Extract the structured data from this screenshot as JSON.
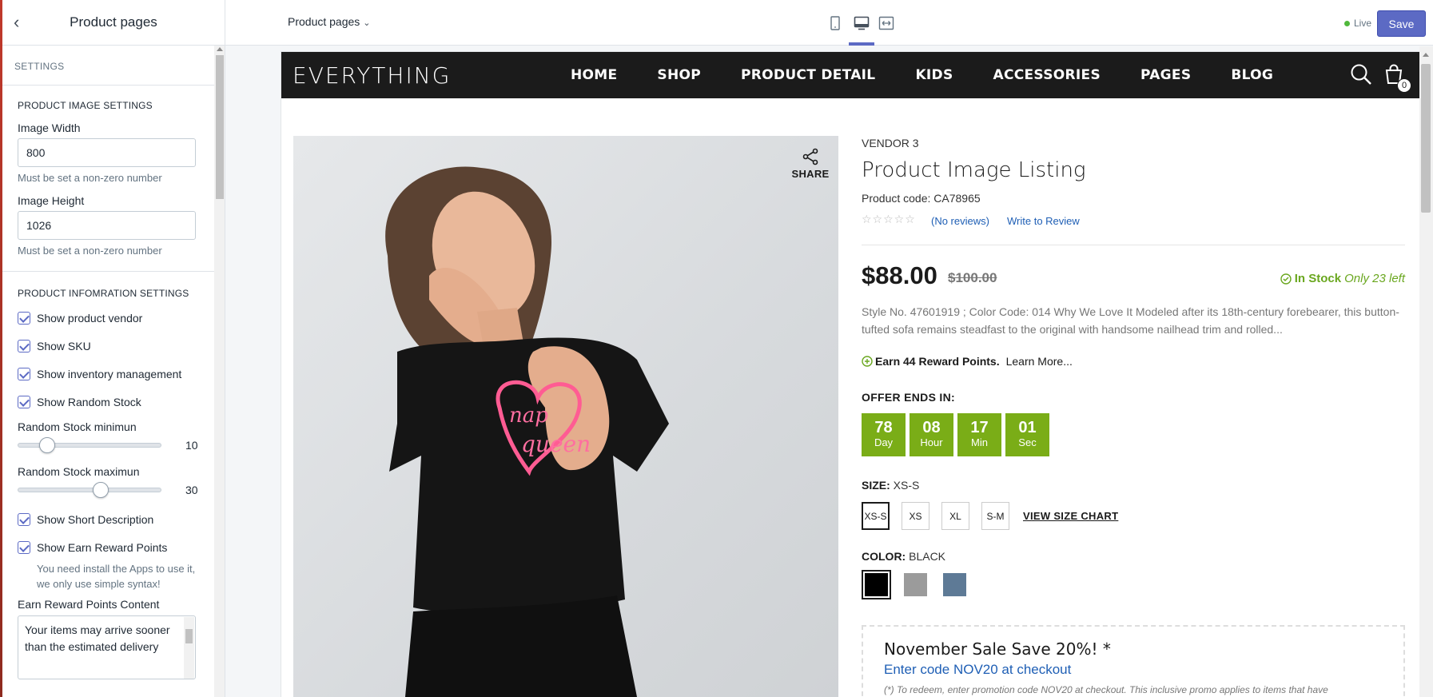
{
  "sidebar": {
    "back_icon": "chevron-left-icon",
    "title": "Product pages",
    "settings_header": "SETTINGS",
    "image_section_title": "PRODUCT IMAGE SETTINGS",
    "image_width_label": "Image Width",
    "image_width_value": "800",
    "image_width_help": "Must be set a non-zero number",
    "image_height_label": "Image Height",
    "image_height_value": "1026",
    "image_height_help": "Must be set a non-zero number",
    "info_section_title": "PRODUCT INFOMRATION SETTINGS",
    "checks": [
      {
        "label": "Show product vendor",
        "checked": true
      },
      {
        "label": "Show SKU",
        "checked": true
      },
      {
        "label": "Show inventory management",
        "checked": true
      },
      {
        "label": "Show Random Stock",
        "checked": true
      }
    ],
    "random_min_label": "Random Stock minimun",
    "random_min_value": "10",
    "random_min_fraction": 0.16,
    "random_max_label": "Random Stock maximun",
    "random_max_value": "30",
    "random_max_fraction": 0.58,
    "checks2": [
      {
        "label": "Show Short Description",
        "checked": true
      },
      {
        "label": "Show Earn Reward Points",
        "checked": true
      }
    ],
    "reward_help": "You need install the Apps to use it, we only use simple syntax!",
    "reward_content_label": "Earn Reward Points Content",
    "reward_content_value": "Your items may arrive sooner than the estimated delivery"
  },
  "topbar": {
    "page_select": "Product pages",
    "devices": [
      "mobile-icon",
      "desktop-icon",
      "fullscreen-icon"
    ],
    "active_device": "desktop-icon",
    "live_label": "Live",
    "save_label": "Save",
    "accent": "#5c6ac4"
  },
  "store": {
    "logo": "EVERYTHING",
    "nav": [
      "HOME",
      "SHOP",
      "PRODUCT DETAIL",
      "KIDS",
      "ACCESSORIES",
      "PAGES",
      "BLOG"
    ],
    "cart_count": "0"
  },
  "product": {
    "share_label": "SHARE",
    "vendor": "VENDOR 3",
    "title": "Product Image Listing",
    "code": "Product code: CA78965",
    "rating_stars": "☆☆☆☆☆",
    "no_reviews": "(No reviews)",
    "write_review": "Write to Review",
    "price": "$88.00",
    "compare_price": "$100.00",
    "in_stock": "In Stock",
    "stock_left": "Only 23 left",
    "description": "Style No. 47601919 ; Color Code: 014 Why We Love It Modeled after its 18th-century forebearer, this button-tufted sofa remains steadfast to the original with handsome nailhead trim and rolled...",
    "reward_text": "Earn 44 Reward Points.",
    "learn_more": "Learn More...",
    "offer_label": "OFFER ENDS IN:",
    "countdown": [
      {
        "num": "78",
        "label": "Day"
      },
      {
        "num": "08",
        "label": "Hour"
      },
      {
        "num": "17",
        "label": "Min"
      },
      {
        "num": "01",
        "label": "Sec"
      }
    ],
    "size_label": "SIZE:",
    "size_value": "XS-S",
    "sizes": [
      "XS-S",
      "XS",
      "XL",
      "S-M"
    ],
    "size_chart": "VIEW SIZE CHART",
    "color_label": "COLOR:",
    "color_value": "BLACK",
    "colors": [
      "#000000",
      "#9b9b9b",
      "#5e7a96"
    ],
    "promo_title": "November Sale Save 20%! *",
    "promo_code": "Enter code NOV20 at checkout",
    "promo_note": "(*) To redeem, enter promotion code NOV20 at checkout. This inclusive promo applies to items that have",
    "in_stock_color": "#6aa71f",
    "countdown_color": "#7aad17"
  }
}
